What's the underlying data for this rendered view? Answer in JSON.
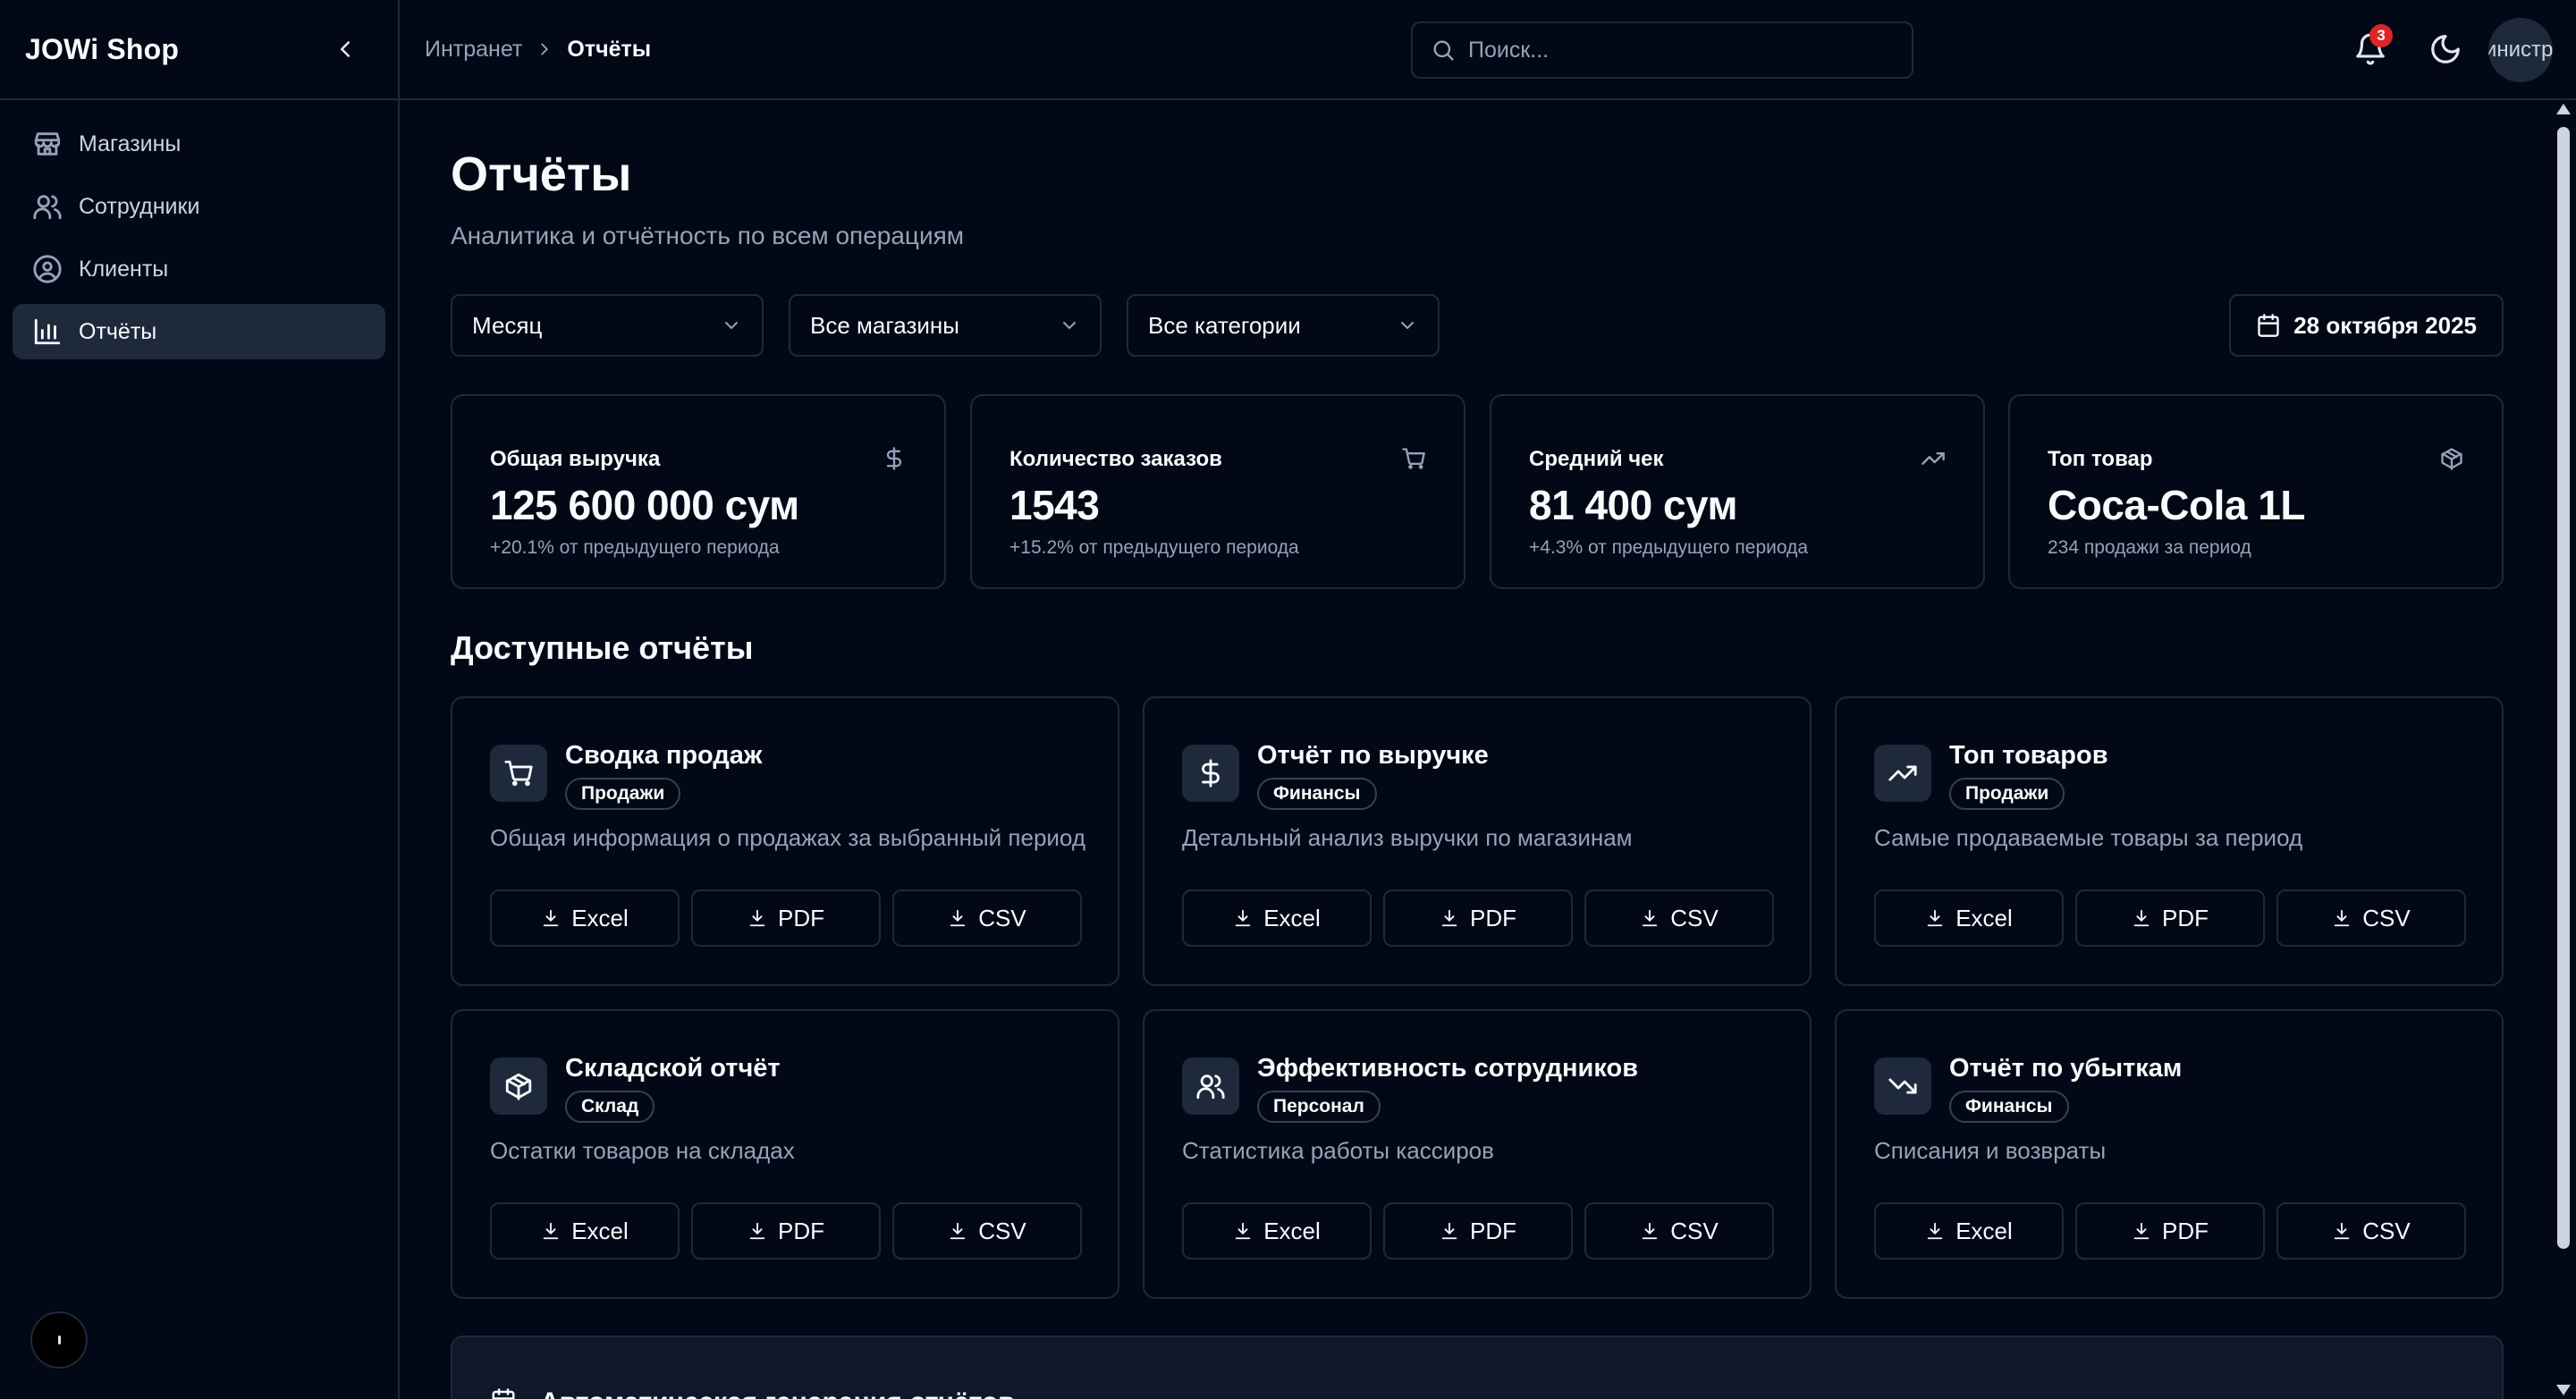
{
  "app": {
    "brand": "JOWi Shop"
  },
  "sidebar": {
    "items": [
      {
        "label": "Магазины",
        "icon": "store-icon",
        "active": false
      },
      {
        "label": "Сотрудники",
        "icon": "users-icon",
        "active": false
      },
      {
        "label": "Клиенты",
        "icon": "user-circle-icon",
        "active": false
      },
      {
        "label": "Отчёты",
        "icon": "bar-chart-icon",
        "active": true
      }
    ]
  },
  "topbar": {
    "breadcrumb": [
      "Интранет",
      "Отчёты"
    ],
    "search_placeholder": "Поиск...",
    "notifications_count": "3",
    "avatar_text": "Администратор"
  },
  "page": {
    "title": "Отчёты",
    "subtitle": "Аналитика и отчётность по всем операциям"
  },
  "filters": {
    "period": "Месяц",
    "stores": "Все магазины",
    "categories": "Все категории",
    "date": "28 октября 2025"
  },
  "stats": [
    {
      "label": "Общая выручка",
      "value": "125 600 000 сум",
      "change": "+20.1% от предыдущего периода",
      "icon": "dollar-icon"
    },
    {
      "label": "Количество заказов",
      "value": "1543",
      "change": "+15.2% от предыдущего периода",
      "icon": "cart-icon"
    },
    {
      "label": "Средний чек",
      "value": "81 400 сум",
      "change": "+4.3% от предыдущего периода",
      "icon": "trending-up-icon"
    },
    {
      "label": "Топ товар",
      "value": "Coca-Cola 1L",
      "change": "234 продажи за период",
      "icon": "package-icon"
    }
  ],
  "reports_section": {
    "title": "Доступные отчёты"
  },
  "export_labels": {
    "excel": "Excel",
    "pdf": "PDF",
    "csv": "CSV"
  },
  "reports": [
    {
      "title": "Сводка продаж",
      "tag": "Продажи",
      "description": "Общая информация о продажах за выбранный период",
      "icon": "cart-icon"
    },
    {
      "title": "Отчёт по выручке",
      "tag": "Финансы",
      "description": "Детальный анализ выручки по магазинам",
      "icon": "dollar-icon"
    },
    {
      "title": "Топ товаров",
      "tag": "Продажи",
      "description": "Самые продаваемые товары за период",
      "icon": "trending-up-icon"
    },
    {
      "title": "Складской отчёт",
      "tag": "Склад",
      "description": "Остатки товаров на складах",
      "icon": "package-icon"
    },
    {
      "title": "Эффективность сотрудников",
      "tag": "Персонал",
      "description": "Статистика работы кассиров",
      "icon": "users-icon"
    },
    {
      "title": "Отчёт по убыткам",
      "tag": "Финансы",
      "description": "Списания и возвраты",
      "icon": "trending-down-icon"
    }
  ],
  "auto_generation": {
    "title": "Автоматическая генерация отчётов",
    "icon": "calendar-icon"
  },
  "colors": {
    "background": "#030817",
    "border": "#1e293b",
    "muted_text": "#94a3b8",
    "active_nav": "#1e293b",
    "badge": "#dc2626"
  }
}
